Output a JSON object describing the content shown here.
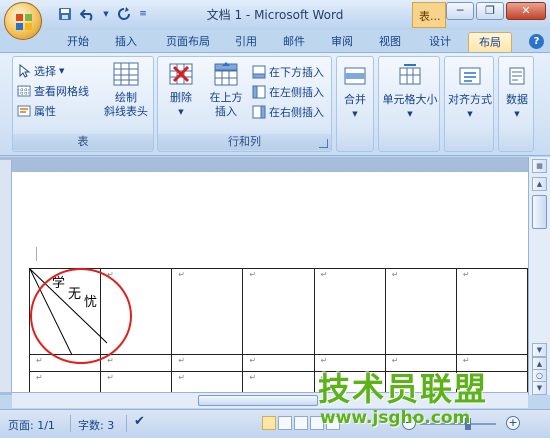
{
  "window": {
    "title": "文档 1 - Microsoft Word",
    "context_tab_title": "表...",
    "minimize": "─",
    "restore": "❐",
    "close": "✕"
  },
  "quick_access": {
    "save_icon": "save-icon",
    "undo_icon": "undo-icon",
    "redo_icon": "redo-icon",
    "customize_icon": "customize-icon"
  },
  "tabs": [
    {
      "label": "开始"
    },
    {
      "label": "插入"
    },
    {
      "label": "页面布局"
    },
    {
      "label": "引用"
    },
    {
      "label": "邮件"
    },
    {
      "label": "审阅"
    },
    {
      "label": "视图"
    },
    {
      "label": "设计"
    },
    {
      "label": "布局"
    }
  ],
  "ribbon": {
    "table_group": {
      "label": "表",
      "select": "选择",
      "view_gridlines": "查看网格线",
      "properties": "属性",
      "draw_diagonal_line1": "绘制",
      "draw_diagonal_line2": "斜线表头"
    },
    "rows_cols_group": {
      "label": "行和列",
      "delete": "删除",
      "insert_above1": "在上方",
      "insert_above2": "插入",
      "insert_below": "在下方插入",
      "insert_left": "在左侧插入",
      "insert_right": "在右侧插入"
    },
    "merge": "合并",
    "cell_size": "单元格大小",
    "alignment": "对齐方式",
    "data": "数据"
  },
  "document": {
    "diag_text": [
      "学",
      "无",
      "忧"
    ],
    "paragraph_mark": "↵"
  },
  "statusbar": {
    "page": "页面: 1/1",
    "words": "字数: 3",
    "zoom_minus": "−",
    "zoom_plus": "+"
  },
  "watermark": {
    "line1": "技术员联盟",
    "line2": "www.jsgho.com"
  },
  "colors": {
    "accent": "#15428b",
    "highlight_circle": "#e0201c",
    "watermark": "#5bb318"
  }
}
